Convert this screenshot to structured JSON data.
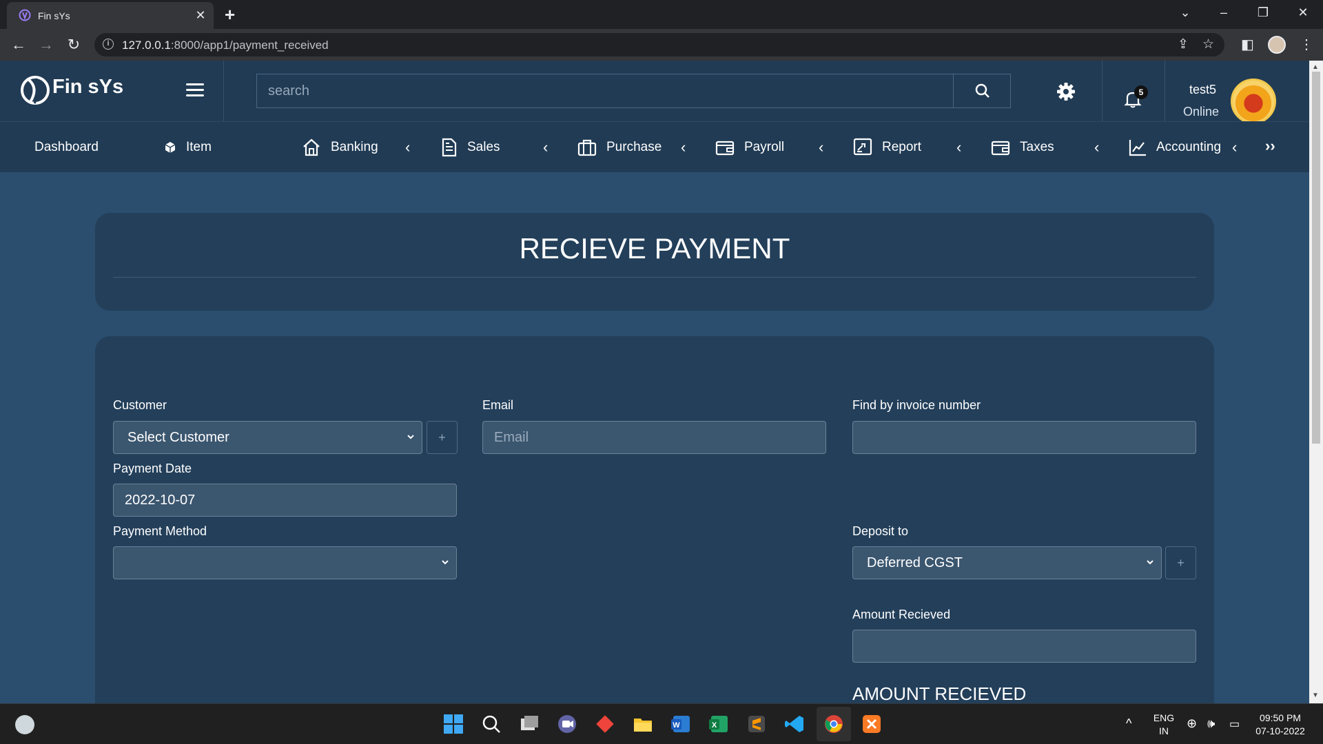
{
  "browser": {
    "tab_title": "Fin sYs",
    "url_host": "127.0.0.1",
    "url_rest": ":8000/app1/payment_received"
  },
  "header": {
    "brand": "Fin sYs",
    "search_placeholder": "search",
    "notification_count": "5",
    "user_name": "test5",
    "user_status": "Online"
  },
  "nav": {
    "items": [
      {
        "label": "Dashboard",
        "icon": "none"
      },
      {
        "label": "Item",
        "icon": "cube-icon"
      },
      {
        "label": "Banking",
        "icon": "home-icon"
      },
      {
        "label": "Sales",
        "icon": "document-icon"
      },
      {
        "label": "Purchase",
        "icon": "briefcase-icon"
      },
      {
        "label": "Payroll",
        "icon": "wallet-icon"
      },
      {
        "label": "Report",
        "icon": "report-icon"
      },
      {
        "label": "Taxes",
        "icon": "wallet-icon"
      },
      {
        "label": "Accounting",
        "icon": "line-chart-icon"
      }
    ],
    "more": "›› "
  },
  "page": {
    "title": "RECIEVE PAYMENT"
  },
  "form": {
    "customer_label": "Customer",
    "customer_value": "Select Customer",
    "email_label": "Email",
    "email_placeholder": "Email",
    "invoice_label": "Find by invoice number",
    "invoice_value": "",
    "payment_date_label": "Payment Date",
    "payment_date_value": "2022-10-07",
    "payment_method_label": "Payment Method",
    "payment_method_value": "",
    "deposit_label": "Deposit to",
    "deposit_value": "Deferred CGST",
    "amount_label": "Amount Recieved",
    "amount_value": "",
    "amount_heading": "AMOUNT RECIEVED",
    "plus": "+"
  },
  "taskbar": {
    "lang_top": "ENG",
    "lang_bottom": "IN",
    "time": "09:50 PM",
    "date": "07-10-2022"
  },
  "colors": {
    "page_bg": "#2b4e6f",
    "header_bg": "#213b54",
    "card_bg": "#233f5a",
    "field_bg": "#3b566f"
  }
}
